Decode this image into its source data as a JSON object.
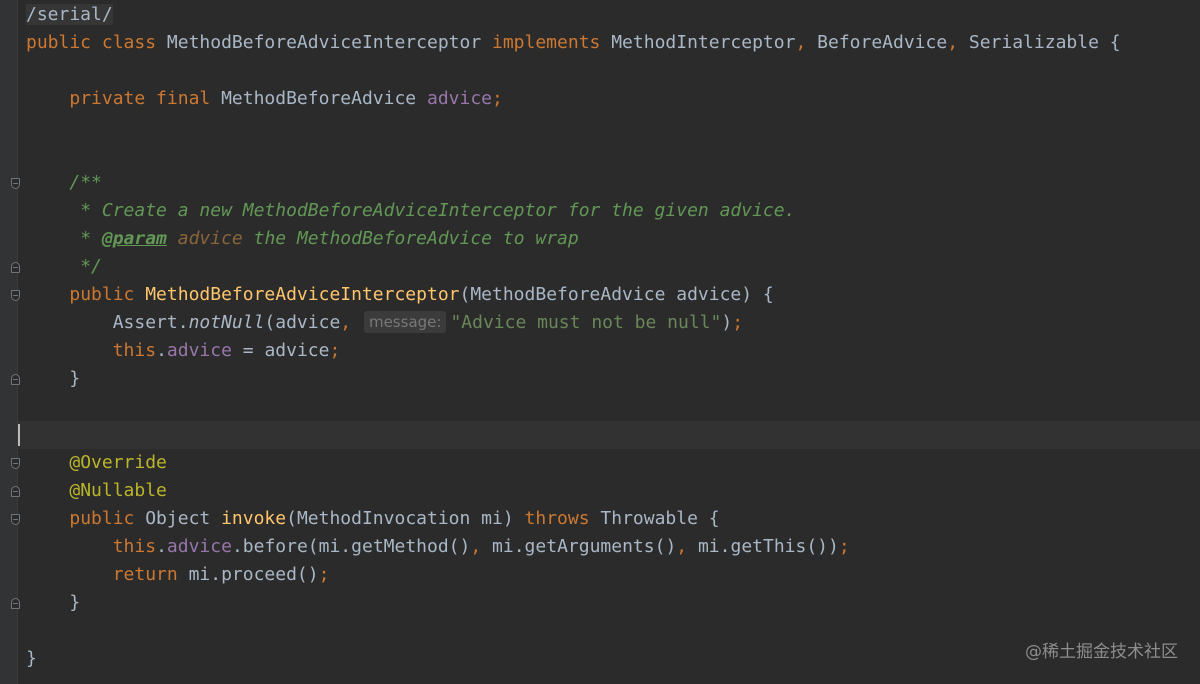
{
  "editor": {
    "path_comment": "/serial/",
    "lines": {
      "l1": {
        "kw1": "public class ",
        "cls": "MethodBeforeAdviceInterceptor ",
        "kw2": "implements ",
        "t1": "MethodInterceptor",
        "p1": ", ",
        "t2": "BeforeAdvice",
        "p2": ", ",
        "t3": "Serializable {"
      },
      "l3": {
        "kw": "private final ",
        "type": "MethodBeforeAdvice ",
        "field": "advice",
        "semi": ";"
      },
      "l6": "/**",
      "l7": " * Create a new MethodBeforeAdviceInterceptor for the given advice.",
      "l8": {
        "pre": " * ",
        "tag": "@param",
        "param": " advice",
        "rest": " the MethodBeforeAdvice to wrap"
      },
      "l9": " */",
      "l10": {
        "kw": "public ",
        "fn": "MethodBeforeAdviceInterceptor",
        "rest": "(MethodBeforeAdvice advice) {"
      },
      "l11": {
        "obj": "Assert.",
        "method": "notNull",
        "args": "(advice",
        "comma": ", ",
        "hint": "message:",
        "str": "\"Advice must not be null\"",
        "close": ")",
        "semi": ";"
      },
      "l12": {
        "kw": "this",
        "dot": ".",
        "field": "advice",
        "rest": " = advice",
        "semi": ";"
      },
      "l13": "}",
      "l16": "@Override",
      "l17": "@Nullable",
      "l18": {
        "kw": "public ",
        "type": "Object ",
        "fn": "invoke",
        "params": "(MethodInvocation mi) ",
        "kw2": "throws ",
        "exc": "Throwable {"
      },
      "l19": {
        "kw": "this",
        "dot": ".",
        "field": "advice",
        "c1": ".before(mi.getMethod()",
        "sep1": ", ",
        "c2": "mi.getArguments()",
        "sep2": ", ",
        "c3": "mi.getThis())",
        "semi": ";"
      },
      "l20": {
        "kw": "return ",
        "rest": "mi.proceed()",
        "semi": ";"
      },
      "l21": "}",
      "l23": "}"
    }
  },
  "watermark": "@稀土掘金技术社区"
}
